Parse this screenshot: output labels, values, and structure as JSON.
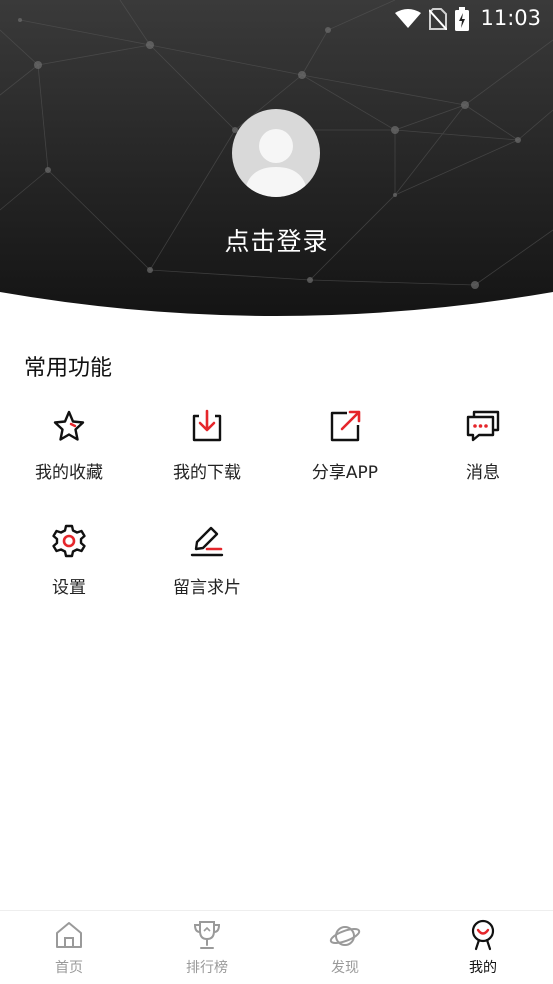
{
  "status_bar": {
    "time": "11:03"
  },
  "profile": {
    "login_text": "点击登录"
  },
  "section": {
    "title": "常用功能"
  },
  "features": [
    {
      "label": "我的收藏",
      "icon": "star-icon"
    },
    {
      "label": "我的下载",
      "icon": "download-icon"
    },
    {
      "label": "分享APP",
      "icon": "share-icon"
    },
    {
      "label": "消息",
      "icon": "message-icon"
    },
    {
      "label": "设置",
      "icon": "gear-icon"
    },
    {
      "label": "留言求片",
      "icon": "edit-icon"
    }
  ],
  "nav": [
    {
      "label": "首页",
      "icon": "home-icon"
    },
    {
      "label": "排行榜",
      "icon": "trophy-icon"
    },
    {
      "label": "发现",
      "icon": "planet-icon"
    },
    {
      "label": "我的",
      "icon": "profile-icon"
    }
  ],
  "colors": {
    "accent": "#e5262b",
    "header_dark": "#1e1e1e",
    "nav_inactive": "#9a9a9a"
  }
}
